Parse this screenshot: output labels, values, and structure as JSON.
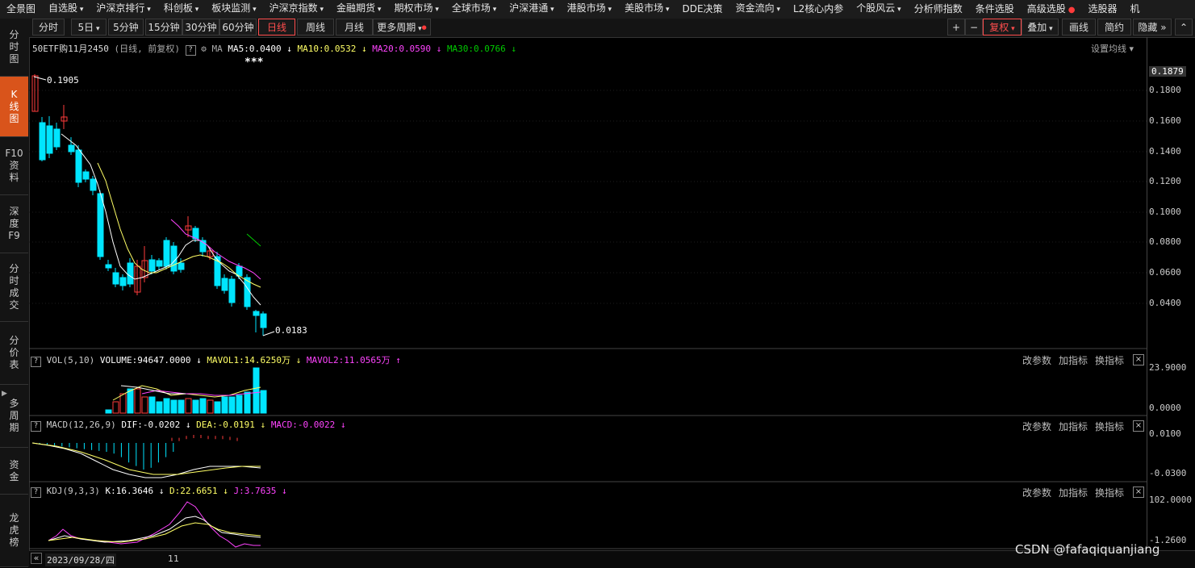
{
  "topnav": {
    "items": [
      "全景图",
      "自选股",
      "沪深京排行",
      "科创板",
      "板块监测",
      "沪深京指数",
      "金融期货",
      "期权市场",
      "全球市场",
      "沪深港通",
      "港股市场",
      "美股市场",
      "DDE决策",
      "资金流向",
      "L2核心内参",
      "个股风云",
      "分析师指数",
      "条件选股",
      "高级选股",
      "选股器",
      "机"
    ]
  },
  "toolbar": {
    "periods": [
      "分时",
      "5日",
      "5分钟",
      "15分钟",
      "30分钟",
      "60分钟",
      "日线",
      "周线",
      "月线",
      "更多周期"
    ],
    "active_period": "日线",
    "right": [
      "+",
      "−",
      "复权",
      "叠加",
      "画线",
      "简约",
      "隐藏"
    ]
  },
  "lefttabs": [
    {
      "label": "分\n时\n图"
    },
    {
      "label": "K\n线\n图",
      "active": true
    },
    {
      "label": "F10\n资\n料"
    },
    {
      "label": "深\n度\nF9"
    },
    {
      "label": "分\n时\n成\n交"
    },
    {
      "label": "分\n价\n表"
    },
    {
      "label": "多\n周\n期"
    },
    {
      "label": "资\n金"
    },
    {
      "label": "龙\n虎\n榜"
    }
  ],
  "main": {
    "name": "50ETF购11月2450",
    "subtitle": "(日线, 前复权)",
    "ma_label": "MA",
    "ma5": "MA5:0.0400",
    "ma10": "MA10:0.0532",
    "ma20": "MA20:0.0590",
    "ma30": "MA30:0.0766",
    "settings": "设置均线",
    "high_label": "0.1905",
    "low_label": "0.0183",
    "stars": "***",
    "yticks": [
      "0.1879",
      "0.1800",
      "0.1600",
      "0.1400",
      "0.1200",
      "0.1000",
      "0.0800",
      "0.0600",
      "0.0400"
    ]
  },
  "vol": {
    "label": "VOL(5,10)",
    "volume": "VOLUME:94647.0000",
    "mavol1": "MAVOL1:14.6250万",
    "mavol2": "MAVOL2:11.0565万",
    "yticks": [
      "23.9000",
      "0.0000"
    ]
  },
  "macd": {
    "label": "MACD(12,26,9)",
    "dif": "DIF:-0.0202",
    "dea": "DEA:-0.0191",
    "macd": "MACD:-0.0022",
    "yticks": [
      "0.0100",
      "-0.0300"
    ]
  },
  "kdj": {
    "label": "KDJ(9,3,3)",
    "k": "K:16.3646",
    "d": "D:22.6651",
    "j": "J:3.7635",
    "yticks": [
      "102.0000",
      "-1.2600"
    ]
  },
  "panel_buttons": [
    "改参数",
    "加指标",
    "换指标"
  ],
  "bottom": {
    "date": "2023/09/28/四",
    "tick": "11"
  },
  "watermark": "CSDN @fafaqiquanjiang",
  "colors": {
    "up": "#ff3b3b",
    "down": "#00e5ff",
    "ma5": "#ffffff",
    "ma10": "#ffff66",
    "ma20": "#ff44ff",
    "ma30": "#00cc00",
    "accent": "#d9541b"
  }
}
